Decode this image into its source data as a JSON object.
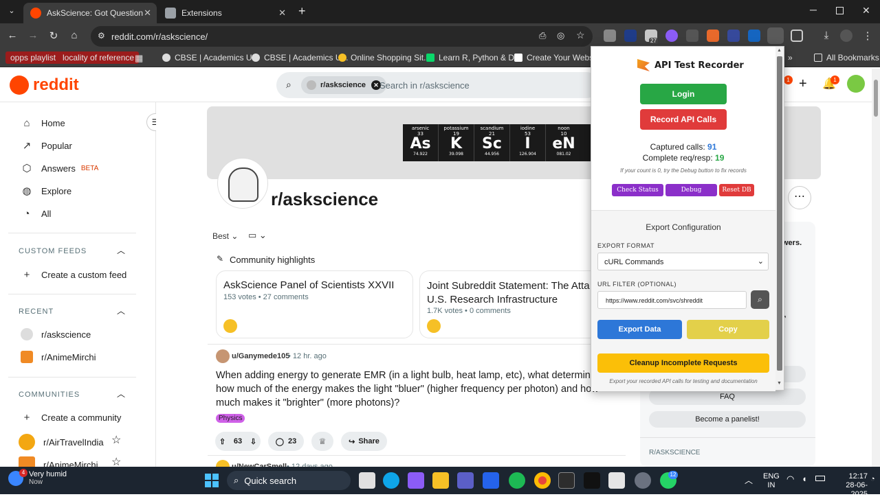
{
  "browser": {
    "tabs": [
      {
        "title": "AskScience: Got Questions? Get",
        "active": true
      },
      {
        "title": "Extensions",
        "active": false
      }
    ],
    "new_tab": "+",
    "url": "reddit.com/r/askscience/",
    "window_controls": [
      "minimize",
      "restore",
      "close"
    ],
    "bookmarks": [
      {
        "label": "opps playlist",
        "color": "#9b1c1c"
      },
      {
        "label": "locality of reference",
        "color": "#9b1c1c"
      },
      {
        "label": "CBSE | Academics U..."
      },
      {
        "label": "CBSE | Academics U..."
      },
      {
        "label": "Online Shopping Sit..."
      },
      {
        "label": "Learn R, Python & D..."
      },
      {
        "label": "Create Your Website..."
      }
    ],
    "all_bookmarks": "All Bookmarks",
    "ext_badge": "27"
  },
  "reddit": {
    "logo_text": "reddit",
    "search_chip": "r/askscience",
    "search_placeholder": "Search in r/askscience",
    "notif_badge": "1",
    "chat_badge": "1",
    "sidebar": {
      "nav": [
        {
          "label": "Home",
          "icon": "home-icon"
        },
        {
          "label": "Popular",
          "icon": "popular-icon"
        },
        {
          "label": "Answers",
          "icon": "answers-icon",
          "badge": "BETA"
        },
        {
          "label": "Explore",
          "icon": "explore-icon"
        },
        {
          "label": "All",
          "icon": "all-icon"
        }
      ],
      "custom_feeds_head": "CUSTOM FEEDS",
      "create_custom_feed": "Create a custom feed",
      "recent_head": "RECENT",
      "recent": [
        "r/askscience",
        "r/AnimeMirchi"
      ],
      "communities_head": "COMMUNITIES",
      "create_community": "Create a community",
      "communities": [
        "r/AirTravelIndia",
        "r/AnimeMirchi"
      ]
    },
    "banner_elements": [
      {
        "name": "arsenic",
        "num": "33",
        "sym": "As",
        "mass": "74.922"
      },
      {
        "name": "potassium",
        "num": "19",
        "sym": "K",
        "mass": "39.098"
      },
      {
        "name": "scandium",
        "num": "21",
        "sym": "Sc",
        "mass": "44.956"
      },
      {
        "name": "iodine",
        "num": "53",
        "sym": "I",
        "mass": "126.904"
      },
      {
        "name": "noon",
        "num": "10",
        "sym": "eN",
        "mass": "081.02"
      }
    ],
    "subreddit_title": "r/askscience",
    "sort_label": "Best",
    "highlights_label": "Community highlights",
    "highlights": [
      {
        "title": "AskScience Panel of Scientists XXVII",
        "meta": "153 votes • 27 comments"
      },
      {
        "title": "Joint Subreddit Statement: The Atta on U.S. Research Infrastructure",
        "meta": "1.7K votes • 0 comments"
      }
    ],
    "post": {
      "author": "u/Ganymede105",
      "time": "• 12 hr. ago",
      "title": "When adding energy to generate EMR (in a light bulb, heat lamp, etc), what determines how much of the energy makes the light \"bluer\" (higher frequency per photon) and how much makes it \"brighter\" (more photons)?",
      "flair": "Physics",
      "votes": "63",
      "comments": "23",
      "share": "Share"
    },
    "next_post_author": "u/NewCarSmell",
    "next_post_time": "• 12 days ago",
    "right_panel": {
      "answers_fragment": "wers.",
      "faq": "FAQ",
      "panelist": "Become a panelist!",
      "section_head": "R/ASKSCIENCE"
    }
  },
  "extension_popup": {
    "title": "API Test Recorder",
    "login": "Login",
    "record": "Record API Calls",
    "captured_label": "Captured calls:",
    "captured_value": "91",
    "complete_label": "Complete req/resp:",
    "complete_value": "19",
    "hint": "If your count is 0, try the Debug button to fix records",
    "check_status": "Check Status",
    "debug": "Debug",
    "reset_db": "Reset DB",
    "export_config": "Export Configuration",
    "export_format_label": "EXPORT FORMAT",
    "export_format_value": "cURL Commands",
    "url_filter_label": "URL FILTER (OPTIONAL)",
    "url_filter_value": "https://www.reddit.com/svc/shreddit",
    "export_data": "Export Data",
    "copy": "Copy",
    "cleanup": "Cleanup Incomplete Requests",
    "footer": "Export your recorded API calls for testing and documentation",
    "colors": {
      "login": "#28a745",
      "record": "#e03b3b",
      "purple": "#8b2fc9",
      "red": "#e03b3b",
      "blue": "#2d77d8",
      "copy": "#e3d04a",
      "cleanup": "#fbbf08",
      "captured": "#2d77d8",
      "complete": "#28a745"
    }
  },
  "taskbar": {
    "weather_temp": "4",
    "weather_text": "Very humid",
    "weather_sub": "Now",
    "search": "Quick search",
    "lang": "ENG",
    "lang_sub": "IN",
    "time": "12:17",
    "date": "28-06-2025",
    "whatsapp_badge": "12"
  }
}
